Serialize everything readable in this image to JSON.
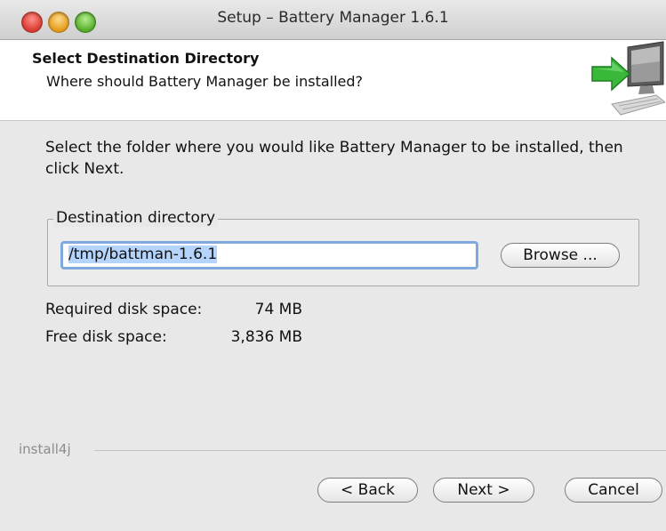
{
  "window": {
    "title": "Setup – Battery Manager 1.6.1"
  },
  "header": {
    "title": "Select Destination Directory",
    "subtitle": "Where should Battery Manager be installed?",
    "icon": "installer-computer-arrow-icon"
  },
  "body": {
    "intro": "Select the folder where you would like Battery Manager to be installed, then click Next.",
    "destination_group_label": "Destination directory",
    "destination_value": "/tmp/battman-1.6.1",
    "browse_label": "Browse ...",
    "required_label": "Required disk space:",
    "required_value": "74 MB",
    "free_label": "Free disk space:",
    "free_value": "3,836 MB"
  },
  "footer": {
    "brand": "install4j",
    "back_label": "< Back",
    "next_label": "Next >",
    "cancel_label": "Cancel"
  },
  "colors": {
    "accent_focus": "#7fa9df",
    "selection": "#b5d4fb",
    "arrow": "#39b83a"
  }
}
